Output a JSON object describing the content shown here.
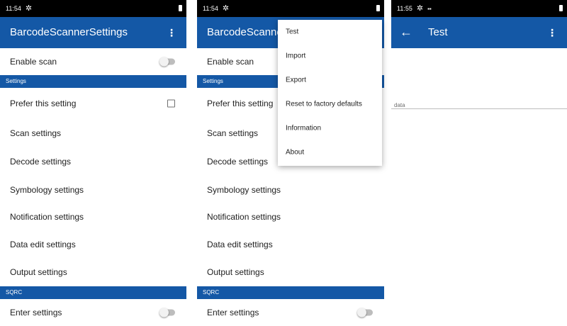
{
  "screen1": {
    "status": {
      "time": "11:54"
    },
    "appbar": {
      "title": "BarcodeScannerSettings",
      "overflow": "⋮"
    },
    "rows": {
      "enable_scan": "Enable scan",
      "section_settings": "Settings",
      "prefer": "Prefer this setting",
      "scan": "Scan settings",
      "decode": "Decode settings",
      "symbology": "Symbology settings",
      "notification": "Notification settings",
      "data_edit": "Data edit settings",
      "output": "Output settings",
      "section_sqrc": "SQRC",
      "enter": "Enter settings"
    },
    "state": {
      "enable_scan_on": false,
      "prefer_checked": false,
      "enter_on": false
    }
  },
  "screen2": {
    "status": {
      "time": "11:54"
    },
    "appbar": {
      "title": "BarcodeScanne",
      "overflow": "⋮"
    },
    "rows": {
      "enable_scan": "Enable scan",
      "section_settings": "Settings",
      "prefer": "Prefer this setting",
      "scan": "Scan settings",
      "decode": "Decode settings",
      "symbology": "Symbology settings",
      "notification": "Notification settings",
      "data_edit": "Data edit settings",
      "output": "Output settings",
      "section_sqrc": "SQRC",
      "enter": "Enter settings"
    },
    "menu": {
      "test": "Test",
      "import": "Import",
      "export": "Export",
      "reset": "Reset to factory defaults",
      "information": "Information",
      "about": "About"
    }
  },
  "screen3": {
    "status": {
      "time": "11:55"
    },
    "appbar": {
      "title": "Test",
      "back": "←",
      "overflow": "⋮"
    },
    "data_label": "data"
  },
  "icons": {
    "gear": "settings-gear-icon",
    "battery": "battery-icon",
    "back": "back-arrow-icon",
    "overflow": "more-vert-icon"
  },
  "colors": {
    "app_bar": "#1458a6",
    "status_bar": "#000000",
    "section_header": "#1458a6",
    "toggle_track": "#bdbdbd"
  }
}
